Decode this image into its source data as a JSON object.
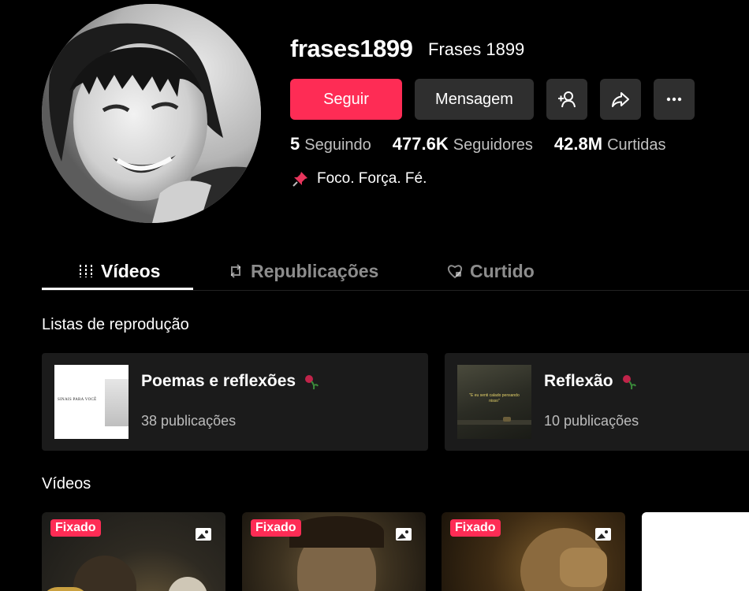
{
  "profile": {
    "username": "frases1899",
    "nickname": "Frases 1899",
    "follow_label": "Seguir",
    "message_label": "Mensagem",
    "bio": "Foco. Força. Fé."
  },
  "stats": [
    {
      "value": "5",
      "label": "Seguindo"
    },
    {
      "value": "477.6K",
      "label": "Seguidores"
    },
    {
      "value": "42.8M",
      "label": "Curtidas"
    }
  ],
  "tabs": [
    {
      "label": "Vídeos"
    },
    {
      "label": "Republicações"
    },
    {
      "label": "Curtido"
    }
  ],
  "sections": {
    "playlists_title": "Listas de reprodução",
    "videos_title": "Vídeos"
  },
  "playlists": [
    {
      "title": "Poemas e reflexões",
      "count": "38 publicações",
      "thumb_text": "SINAIS PARA VOCÊ"
    },
    {
      "title": "Reflexão",
      "count": "10 publicações",
      "thumb_text": "\"E eu senti calado pensando nisso\""
    }
  ],
  "videos": [
    {
      "badge": "Fixado"
    },
    {
      "badge": "Fixado"
    },
    {
      "badge": "Fixado"
    }
  ],
  "colors": {
    "accent": "#fe2c55",
    "button_dark": "#2f2f2f",
    "card": "#1b1b1b"
  }
}
